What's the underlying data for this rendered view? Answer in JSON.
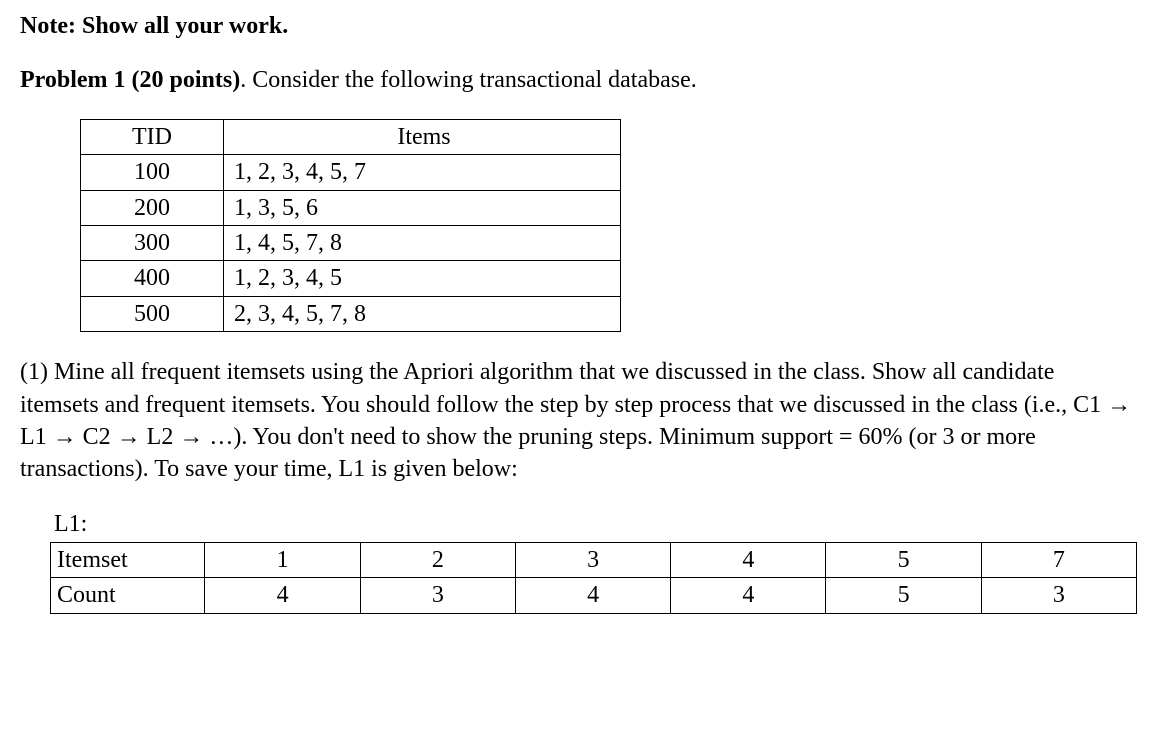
{
  "note_label": "Note: Show all your work.",
  "problem": {
    "heading": "Problem 1 (20 points)",
    "intro_rest": ". Consider the following transactional database."
  },
  "tx_table": {
    "headers": {
      "tid": "TID",
      "items": "Items"
    },
    "rows": [
      {
        "tid": "100",
        "items": "1, 2, 3, 4, 5, 7"
      },
      {
        "tid": "200",
        "items": "1, 3, 5, 6"
      },
      {
        "tid": "300",
        "items": "1, 4, 5, 7, 8"
      },
      {
        "tid": "400",
        "items": "1, 2, 3, 4, 5"
      },
      {
        "tid": "500",
        "items": "2, 3, 4, 5, 7, 8"
      }
    ]
  },
  "question1": "(1) Mine all frequent itemsets using the Apriori algorithm that we discussed in the class. Show all candidate itemsets and frequent itemsets. You should follow the step by step process that we discussed in the class  (i.e., C1 → L1 → C2 → L2 → …). You don't need to show the pruning steps. Minimum support = 60% (or 3 or more transactions). To save your time, L1 is given below:",
  "l1": {
    "caption": "L1:",
    "row_labels": {
      "itemset": "Itemset",
      "count": "Count"
    },
    "cols": [
      {
        "itemset": "1",
        "count": "4"
      },
      {
        "itemset": "2",
        "count": "3"
      },
      {
        "itemset": "3",
        "count": "4"
      },
      {
        "itemset": "4",
        "count": "4"
      },
      {
        "itemset": "5",
        "count": "5"
      },
      {
        "itemset": "7",
        "count": "3"
      }
    ]
  }
}
